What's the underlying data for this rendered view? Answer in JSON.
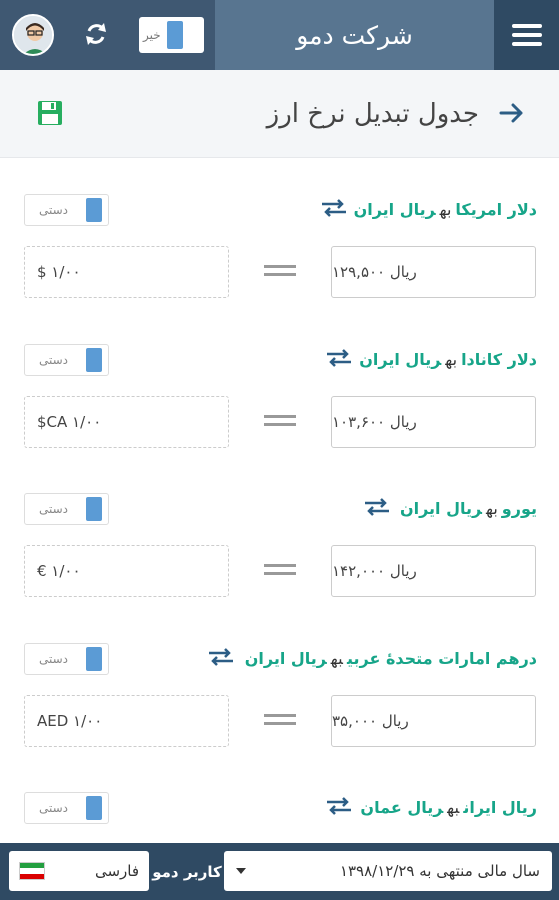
{
  "header": {
    "company_name": "شرکت دمو",
    "toggle_label": "خیر",
    "icons": {
      "menu": "hamburger-icon",
      "refresh": "refresh-icon",
      "avatar": "user-avatar"
    }
  },
  "titlebar": {
    "title": "جدول تبدیل نرخ ارز",
    "icons": {
      "back": "arrow-right-icon",
      "save": "floppy-disk-icon"
    }
  },
  "rates": [
    {
      "from": "دلار امریکا",
      "connector": "به",
      "to": "ریال ایران",
      "mode": "دستی",
      "foreign_value": "$ ۱/۰۰",
      "rial_value": "ریال ۱۲۹,۵۰۰"
    },
    {
      "from": "دلار کانادا",
      "connector": "به",
      "to": "ریال ایران",
      "mode": "دستی",
      "foreign_value": "$CA ۱/۰۰",
      "rial_value": "ریال ۱۰۳,۶۰۰"
    },
    {
      "from": "یورو",
      "connector": "به",
      "to": "ریال ایران",
      "mode": "دستی",
      "foreign_value": "€ ۱/۰۰",
      "rial_value": "ریال ۱۴۲,۰۰۰"
    },
    {
      "from": "درهم امارات متحدهٔ عربی",
      "connector": "به",
      "to": "ریال ایران",
      "mode": "دستی",
      "foreign_value": "AED ۱/۰۰",
      "rial_value": "ریال ۳۵,۰۰۰"
    },
    {
      "from": "ریال ایران",
      "connector": "به",
      "to": "ریال عمان",
      "mode": "دستی"
    }
  ],
  "bottombar": {
    "language": "فارسی",
    "user": "کاربر دمو",
    "fiscal_year": "سال مالی منتهی به ۱۳۹۸/۱۲/۲۹",
    "colors": {
      "flag_green": "#239f40",
      "flag_white": "#ffffff",
      "flag_red": "#da0000"
    }
  },
  "colors": {
    "header": "#3f5872",
    "brand": "#587590",
    "accent": "#17a589",
    "toggle": "#5b9bd5"
  }
}
